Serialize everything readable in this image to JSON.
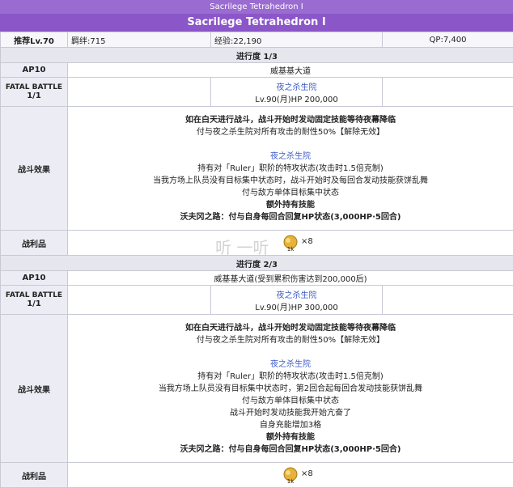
{
  "header": {
    "small_title": "Sacrilege Tetrahedron Ⅰ",
    "main_title": "Sacrilege Tetrahedron Ⅰ"
  },
  "info": {
    "rec_level": "推荐Lv.70",
    "bond": "羁绊:715",
    "exp": "经验:22,190",
    "qp": "QP:7,400"
  },
  "progress1": {
    "title": "进行度 1/3",
    "ap_label": "AP10",
    "location": "威基基大道",
    "fatal_label": "FATAL BATTLE",
    "fatal_count": "1/1",
    "enemy_name": "夜之杀生院",
    "enemy_stats": "Lv.90(月)HP 200,000",
    "effect_label": "战斗效果",
    "effects": [
      {
        "text": "如在白天进行战斗，战斗开始时发动固定技能等待夜幕降临",
        "bold": true,
        "blue": false
      },
      {
        "text": "付与夜之杀生院对所有攻击的耐性50%【解除无效】",
        "bold": false,
        "blue": false
      },
      {
        "text": "",
        "bold": false,
        "blue": false
      },
      {
        "text": "夜之杀生院",
        "bold": false,
        "blue": true
      },
      {
        "text": "持有对「Ruler」职阶的特攻状态(攻击时1.5倍克制)",
        "bold": false,
        "blue": false
      },
      {
        "text": "当我方场上队员没有目标集中状态时，战斗开始时及每回合发动技能获饼乱舞",
        "bold": false,
        "blue": false
      },
      {
        "text": "付与敌方单体目标集中状态",
        "bold": false,
        "blue": false
      },
      {
        "text": "额外持有技能",
        "bold": true,
        "blue": false
      },
      {
        "text": "沃夫冈之路：付与自身每回合回复HP状态(3,000HP·5回合)",
        "bold": false,
        "blue": false
      }
    ],
    "loot_label": "战利品",
    "loot_icon_text": "1k",
    "loot_count": "×8"
  },
  "progress2": {
    "title": "进行度 2/3",
    "ap_label": "AP10",
    "location": "威基基大道(受到累积伤害达到200,000后)",
    "fatal_label": "FATAL BATTLE",
    "fatal_count": "1/1",
    "enemy_name": "夜之杀生院",
    "enemy_stats": "Lv.90(月)HP 300,000",
    "effect_label": "战斗效果",
    "effects": [
      {
        "text": "如在白天进行战斗，战斗开始时发动固定技能等待夜幕降临",
        "bold": true,
        "blue": false
      },
      {
        "text": "付与夜之杀生院对所有攻击的耐性50%【解除无效】",
        "bold": false,
        "blue": false
      },
      {
        "text": "",
        "bold": false,
        "blue": false
      },
      {
        "text": "夜之杀生院",
        "bold": false,
        "blue": true
      },
      {
        "text": "持有对「Ruler」职阶的特攻状态(攻击时1.5倍克制)",
        "bold": false,
        "blue": false
      },
      {
        "text": "当我方场上队员没有目标集中状态时，第2回合起每回合发动技能获饼乱舞",
        "bold": false,
        "blue": false
      },
      {
        "text": "付与敌方单体目标集中状态",
        "bold": false,
        "blue": false
      },
      {
        "text": "战斗开始时发动技能我开始亢奋了",
        "bold": false,
        "blue": false
      },
      {
        "text": "自身充能增加3格",
        "bold": false,
        "blue": false
      },
      {
        "text": "额外持有技能",
        "bold": true,
        "blue": false
      },
      {
        "text": "沃夫冈之路：付与自身每回合回复HP状态(3,000HP·5回合)",
        "bold": false,
        "blue": false
      }
    ],
    "loot_label": "战利品",
    "loot_icon_text": "1k",
    "loot_count": "×8"
  },
  "watermark": "听 一听"
}
